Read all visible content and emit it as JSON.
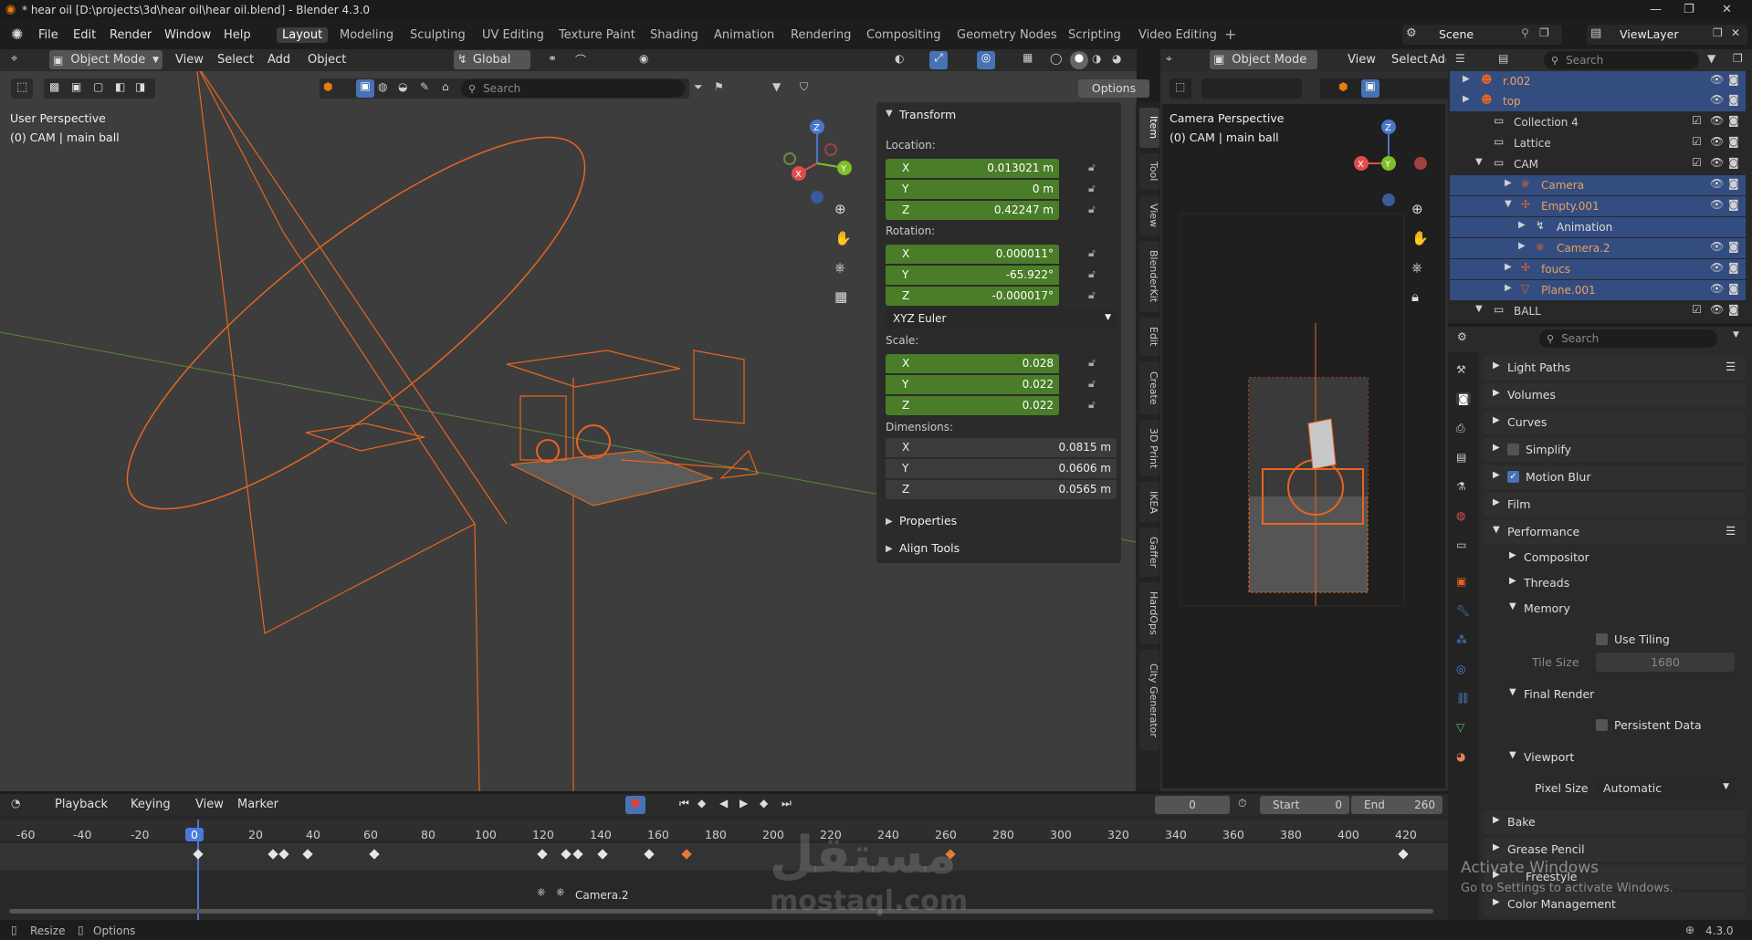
{
  "titlebar": {
    "title": "* hear oil [D:\\projects\\3d\\hear oil\\hear oil.blend] - Blender 4.3.0",
    "minimize": "—",
    "maximize": "❐",
    "close": "✕"
  },
  "menubar": {
    "menus": [
      "File",
      "Edit",
      "Render",
      "Window",
      "Help"
    ],
    "workspaces": [
      "Layout",
      "Modeling",
      "Sculpting",
      "UV Editing",
      "Texture Paint",
      "Shading",
      "Animation",
      "Rendering",
      "Compositing",
      "Geometry Nodes",
      "Scripting",
      "Video Editing"
    ],
    "active_workspace": "Layout",
    "scene": "Scene",
    "view_layer": "ViewLayer"
  },
  "viewport": {
    "mode": "Object Mode",
    "menus": [
      "View",
      "Select",
      "Add",
      "Object"
    ],
    "orientation": "Global",
    "search_placeholder": "Search",
    "options": "Options",
    "perspective": "User Perspective",
    "context": "(0) CAM | main ball"
  },
  "npanel": {
    "transform": "Transform",
    "location_label": "Location:",
    "location": {
      "x": "0.013021 m",
      "y": "0 m",
      "z": "0.42247 m"
    },
    "rotation_label": "Rotation:",
    "rotation": {
      "x": "0.000011°",
      "y": "-65.922°",
      "z": "-0.000017°"
    },
    "rotation_mode": "XYZ Euler",
    "scale_label": "Scale:",
    "scale": {
      "x": "0.028",
      "y": "0.022",
      "z": "0.022"
    },
    "dimensions_label": "Dimensions:",
    "dimensions": {
      "x": "0.0815 m",
      "y": "0.0606 m",
      "z": "0.0565 m"
    },
    "properties": "Properties",
    "align_tools": "Align Tools",
    "axis_x": "X",
    "axis_y": "Y",
    "axis_z": "Z",
    "tabs": [
      "Item",
      "Tool",
      "View",
      "BlenderKit",
      "Edit",
      "Create",
      "3D Print",
      "IKEA",
      "Gaffer",
      "HardOps",
      "City Generator"
    ]
  },
  "camera_view": {
    "mode": "Object Mode",
    "menus": [
      "View",
      "Select",
      "Add"
    ],
    "perspective": "Camera Perspective",
    "context": "(0) CAM | main ball"
  },
  "outliner": {
    "search_placeholder": "Search",
    "rows": [
      {
        "label": "r.002",
        "selected": true
      },
      {
        "label": "top",
        "selected": true
      },
      {
        "label": "Collection 4",
        "selected": false
      },
      {
        "label": "Lattice",
        "selected": false
      },
      {
        "label": "CAM",
        "selected": false
      },
      {
        "label": "Camera",
        "selected": true
      },
      {
        "label": "Empty.001",
        "selected": true
      },
      {
        "label": "Animation",
        "selected": true
      },
      {
        "label": "Camera.2",
        "selected": true
      },
      {
        "label": "foucs",
        "selected": true
      },
      {
        "label": "Plane.001",
        "selected": true
      },
      {
        "label": "BALL",
        "selected": false
      }
    ]
  },
  "properties": {
    "search_placeholder": "Search",
    "sections": {
      "light_paths": "Light Paths",
      "volumes": "Volumes",
      "curves": "Curves",
      "simplify": "Simplify",
      "motion_blur": "Motion Blur",
      "film": "Film",
      "performance": "Performance",
      "compositor": "Compositor",
      "threads": "Threads",
      "memory": "Memory",
      "use_tiling": "Use Tiling",
      "tile_size_label": "Tile Size",
      "tile_size": "1680",
      "final_render": "Final Render",
      "persistent_data": "Persistent Data",
      "viewport": "Viewport",
      "pixel_size_label": "Pixel Size",
      "pixel_size": "Automatic",
      "bake": "Bake",
      "grease_pencil": "Grease Pencil",
      "freestyle": "Freestyle",
      "color_management": "Color Management"
    }
  },
  "timeline": {
    "menus": [
      "Playback",
      "Keying",
      "View",
      "Marker"
    ],
    "current_frame": "0",
    "start_label": "Start",
    "start": "0",
    "end_label": "End",
    "end": "260",
    "ticks": [
      "-60",
      "-40",
      "-20",
      "0",
      "20",
      "40",
      "60",
      "80",
      "100",
      "120",
      "140",
      "160",
      "180",
      "200",
      "220",
      "240",
      "260",
      "280",
      "300",
      "320",
      "340",
      "360",
      "380",
      "400",
      "420"
    ],
    "marker": "Camera.2"
  },
  "watermark": {
    "arabic": "مستقل",
    "latin": "mostaql.com"
  },
  "activate": {
    "title": "Activate Windows",
    "subtitle": "Go to Settings to activate Windows."
  },
  "statusbar": {
    "resize": "Resize",
    "options": "Options",
    "version": "4.3.0"
  },
  "colors": {
    "accent": "#4a7d28",
    "selection": "#e8651f",
    "outliner_sel": "#334d80"
  }
}
